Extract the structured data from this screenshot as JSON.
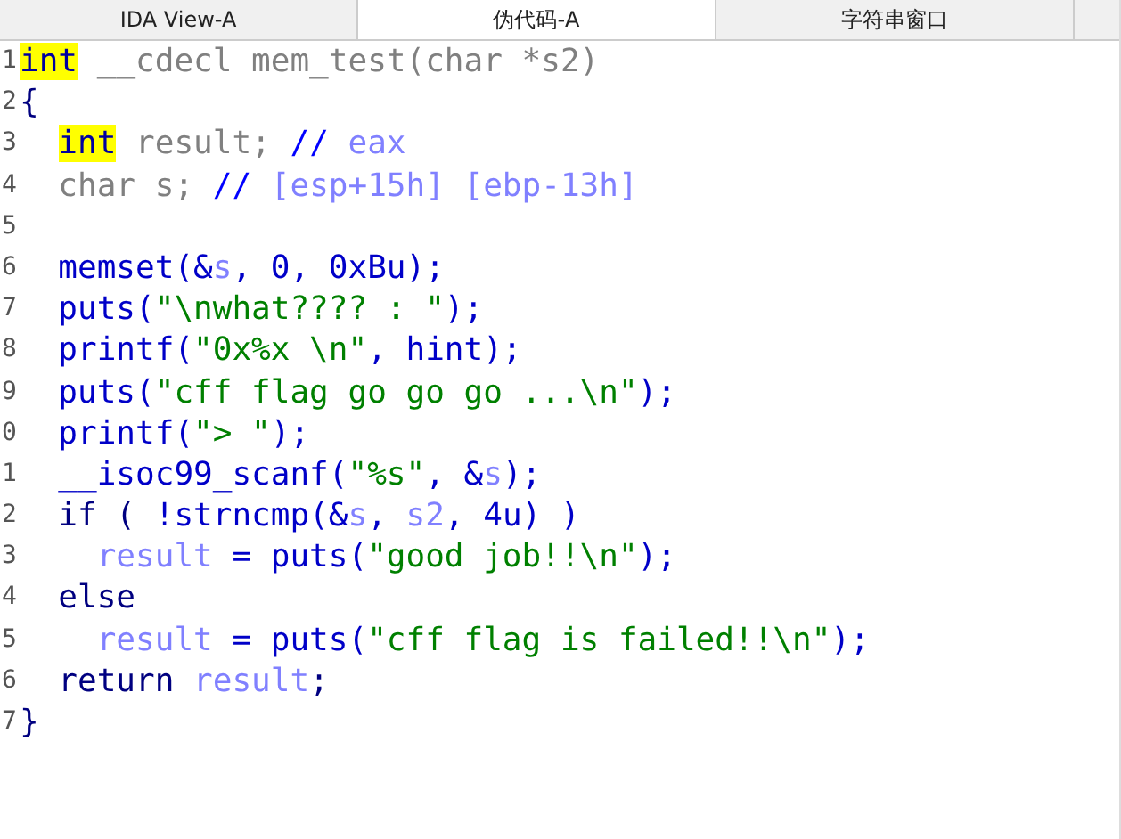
{
  "tabs": [
    {
      "label": "IDA View-A",
      "selected": false
    },
    {
      "label": "伪代码-A",
      "selected": true
    },
    {
      "label": "字符串窗口",
      "selected": false
    }
  ],
  "code": [
    {
      "number": "1",
      "kind": "top",
      "tokens": [
        {
          "kind": "hl",
          "text": "int"
        },
        {
          "kind": "decl",
          "text": " __cdecl mem_test(char *s2)"
        }
      ]
    },
    {
      "number": "2",
      "kind": "top",
      "tokens": [
        {
          "kind": "punct",
          "text": "{"
        }
      ]
    },
    {
      "number": "3",
      "kind": "body",
      "tokens": [
        {
          "kind": "hl",
          "text": "int"
        },
        {
          "kind": "decl",
          "text": " result; "
        },
        {
          "kind": "comment",
          "text": "// "
        },
        {
          "kind": "var",
          "text": "eax"
        }
      ]
    },
    {
      "number": "4",
      "kind": "body",
      "tokens": [
        {
          "kind": "decl",
          "text": "char s; "
        },
        {
          "kind": "comment",
          "text": "// "
        },
        {
          "kind": "var",
          "text": "[esp+15h] [ebp-13h]"
        }
      ]
    },
    {
      "number": "5"
    },
    {
      "number": "6",
      "kind": "body",
      "tokens": [
        {
          "kind": "code",
          "text": "memset(&"
        },
        {
          "kind": "var",
          "text": "s"
        },
        {
          "kind": "code",
          "text": ", 0, 0xBu);"
        }
      ]
    },
    {
      "number": "7",
      "kind": "body",
      "tokens": [
        {
          "kind": "code",
          "text": "puts("
        },
        {
          "kind": "str",
          "text": "\"\\nwhat???? : \""
        },
        {
          "kind": "code",
          "text": ");"
        }
      ]
    },
    {
      "number": "8",
      "kind": "body",
      "tokens": [
        {
          "kind": "code",
          "text": "printf("
        },
        {
          "kind": "str",
          "text": "\"0x%x \\n\""
        },
        {
          "kind": "code",
          "text": ", hint);"
        }
      ]
    },
    {
      "number": "9",
      "kind": "body",
      "tokens": [
        {
          "kind": "code",
          "text": "puts("
        },
        {
          "kind": "str",
          "text": "\"cff flag go go go ...\\n\""
        },
        {
          "kind": "code",
          "text": ");"
        }
      ]
    },
    {
      "number": "0",
      "kind": "body",
      "tokens": [
        {
          "kind": "code",
          "text": "printf("
        },
        {
          "kind": "str",
          "text": "\"> \""
        },
        {
          "kind": "code",
          "text": ");"
        }
      ]
    },
    {
      "number": "1",
      "kind": "body",
      "tokens": [
        {
          "kind": "code",
          "text": "__isoc99_scanf("
        },
        {
          "kind": "str",
          "text": "\"%s\""
        },
        {
          "kind": "code",
          "text": ", &"
        },
        {
          "kind": "var",
          "text": "s"
        },
        {
          "kind": "code",
          "text": ");"
        }
      ]
    },
    {
      "number": "2",
      "kind": "body",
      "tokens": [
        {
          "kind": "punct",
          "text": "if ( "
        },
        {
          "kind": "code",
          "text": "!strncmp(&"
        },
        {
          "kind": "var",
          "text": "s"
        },
        {
          "kind": "code",
          "text": ", "
        },
        {
          "kind": "var",
          "text": "s2"
        },
        {
          "kind": "code",
          "text": ", 4u) )"
        }
      ]
    },
    {
      "number": "3",
      "kind": "nested",
      "tokens": [
        {
          "kind": "var",
          "text": "result"
        },
        {
          "kind": "code",
          "text": " = puts("
        },
        {
          "kind": "str",
          "text": "\"good job!!\\n\""
        },
        {
          "kind": "code",
          "text": ");"
        }
      ]
    },
    {
      "number": "4",
      "kind": "body",
      "tokens": [
        {
          "kind": "punct",
          "text": "else"
        }
      ]
    },
    {
      "number": "5",
      "kind": "nested",
      "tokens": [
        {
          "kind": "var",
          "text": "result"
        },
        {
          "kind": "code",
          "text": " = puts("
        },
        {
          "kind": "str",
          "text": "\"cff flag is failed!!\\n\""
        },
        {
          "kind": "code",
          "text": ");"
        }
      ]
    },
    {
      "number": "6",
      "kind": "body",
      "tokens": [
        {
          "kind": "punct",
          "text": "return "
        },
        {
          "kind": "var",
          "text": "result"
        },
        {
          "kind": "punct",
          "text": ";"
        }
      ]
    },
    {
      "number": "7",
      "kind": "top",
      "tokens": [
        {
          "kind": "punct",
          "text": "}"
        }
      ]
    }
  ]
}
